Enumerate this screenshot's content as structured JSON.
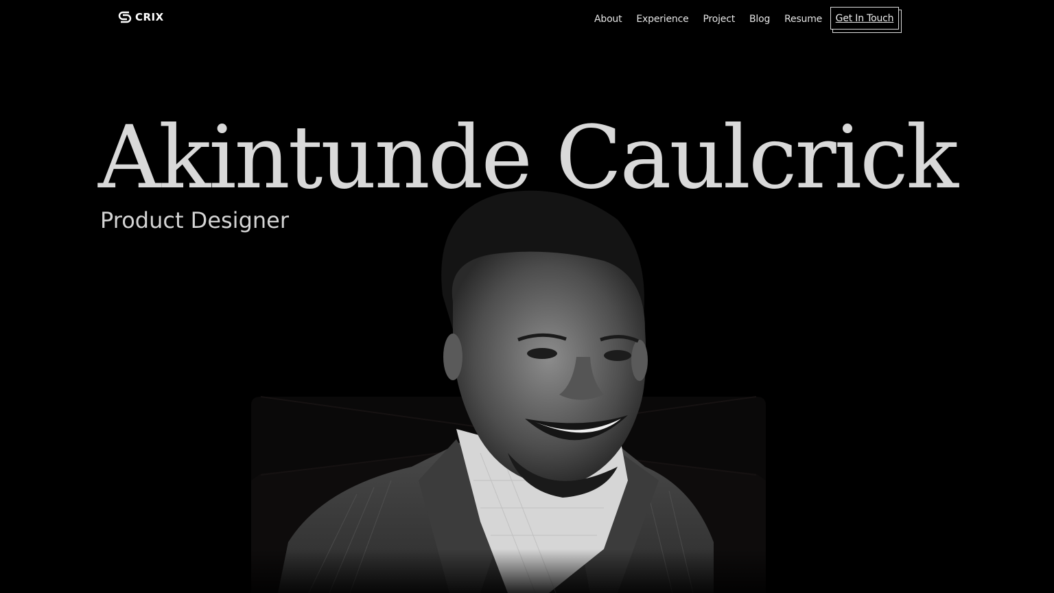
{
  "logo": {
    "text": "CRIX",
    "icon": "crix-logo-icon"
  },
  "nav": {
    "items": [
      {
        "label": "About"
      },
      {
        "label": "Experience"
      },
      {
        "label": "Project"
      },
      {
        "label": "Blog"
      },
      {
        "label": "Resume"
      }
    ],
    "cta_label": "Get In Touch"
  },
  "hero": {
    "name": "Akintunde Caulcrick",
    "role": "Product Designer"
  },
  "colors": {
    "background": "#000000",
    "text": "#d9d9d9",
    "panel": "#0b0a0a"
  }
}
